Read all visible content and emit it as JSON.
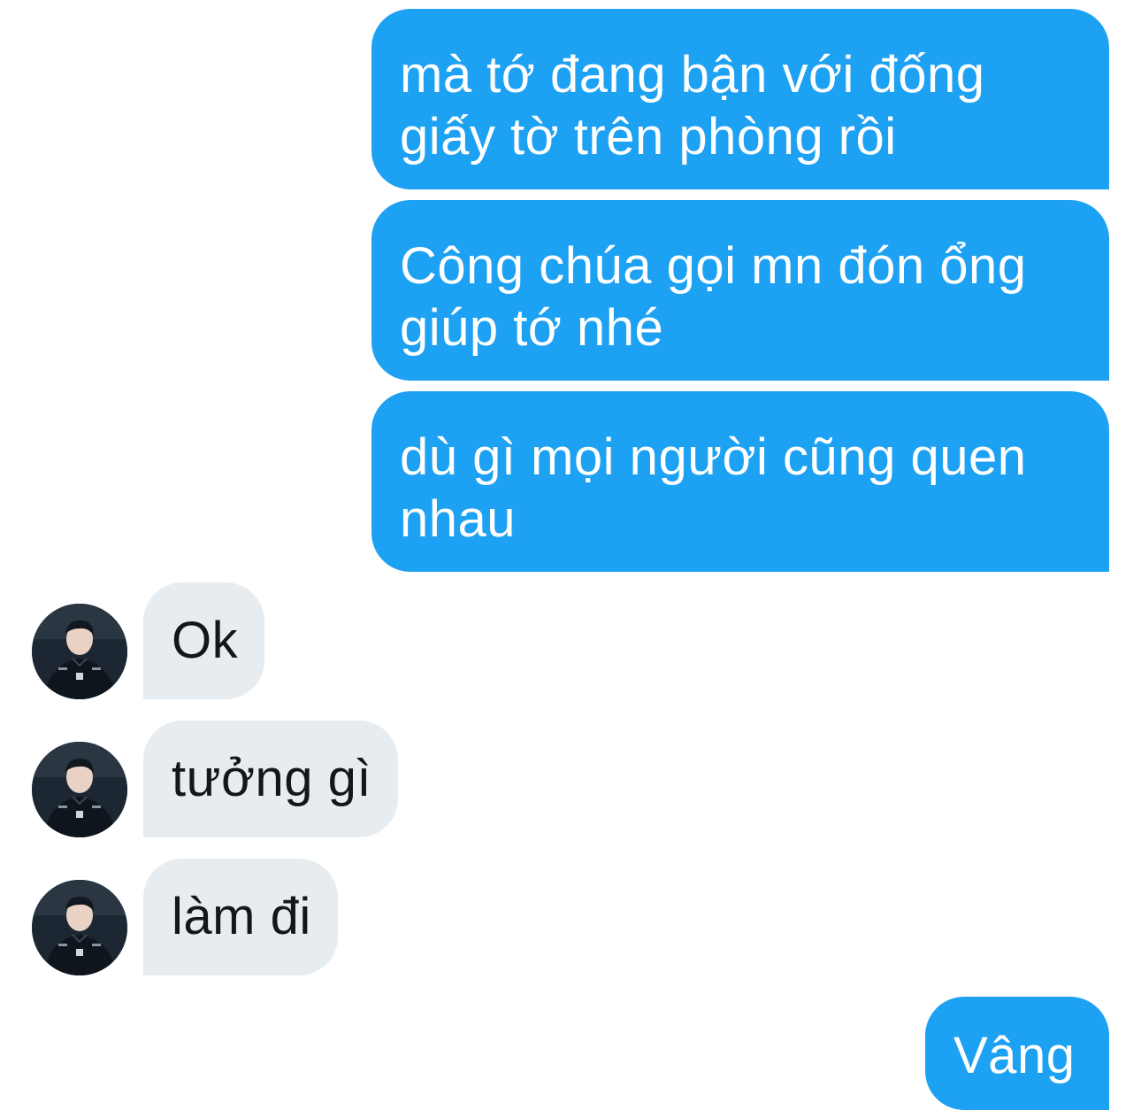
{
  "conversation": {
    "outgoing": [
      {
        "lines": [
          "mà tớ đang bận với đống",
          "giấy tờ trên phòng rồi"
        ]
      },
      {
        "lines": [
          "Công chúa gọi mn đón ổng",
          "giúp tớ nhé"
        ]
      },
      {
        "lines": [
          "dù gì mọi người cũng quen",
          "nhau"
        ]
      }
    ],
    "incoming": [
      {
        "text": "Ok"
      },
      {
        "text": "tưởng gì"
      },
      {
        "text": "làm đi"
      }
    ],
    "final_outgoing": {
      "text": "Vâng"
    }
  },
  "colors": {
    "outgoing_bubble": "#1da1f2",
    "incoming_bubble": "#e6ecf0",
    "incoming_text": "#14171a",
    "outgoing_text": "#ffffff"
  },
  "icons": {
    "avatar": "user-avatar-photo"
  }
}
